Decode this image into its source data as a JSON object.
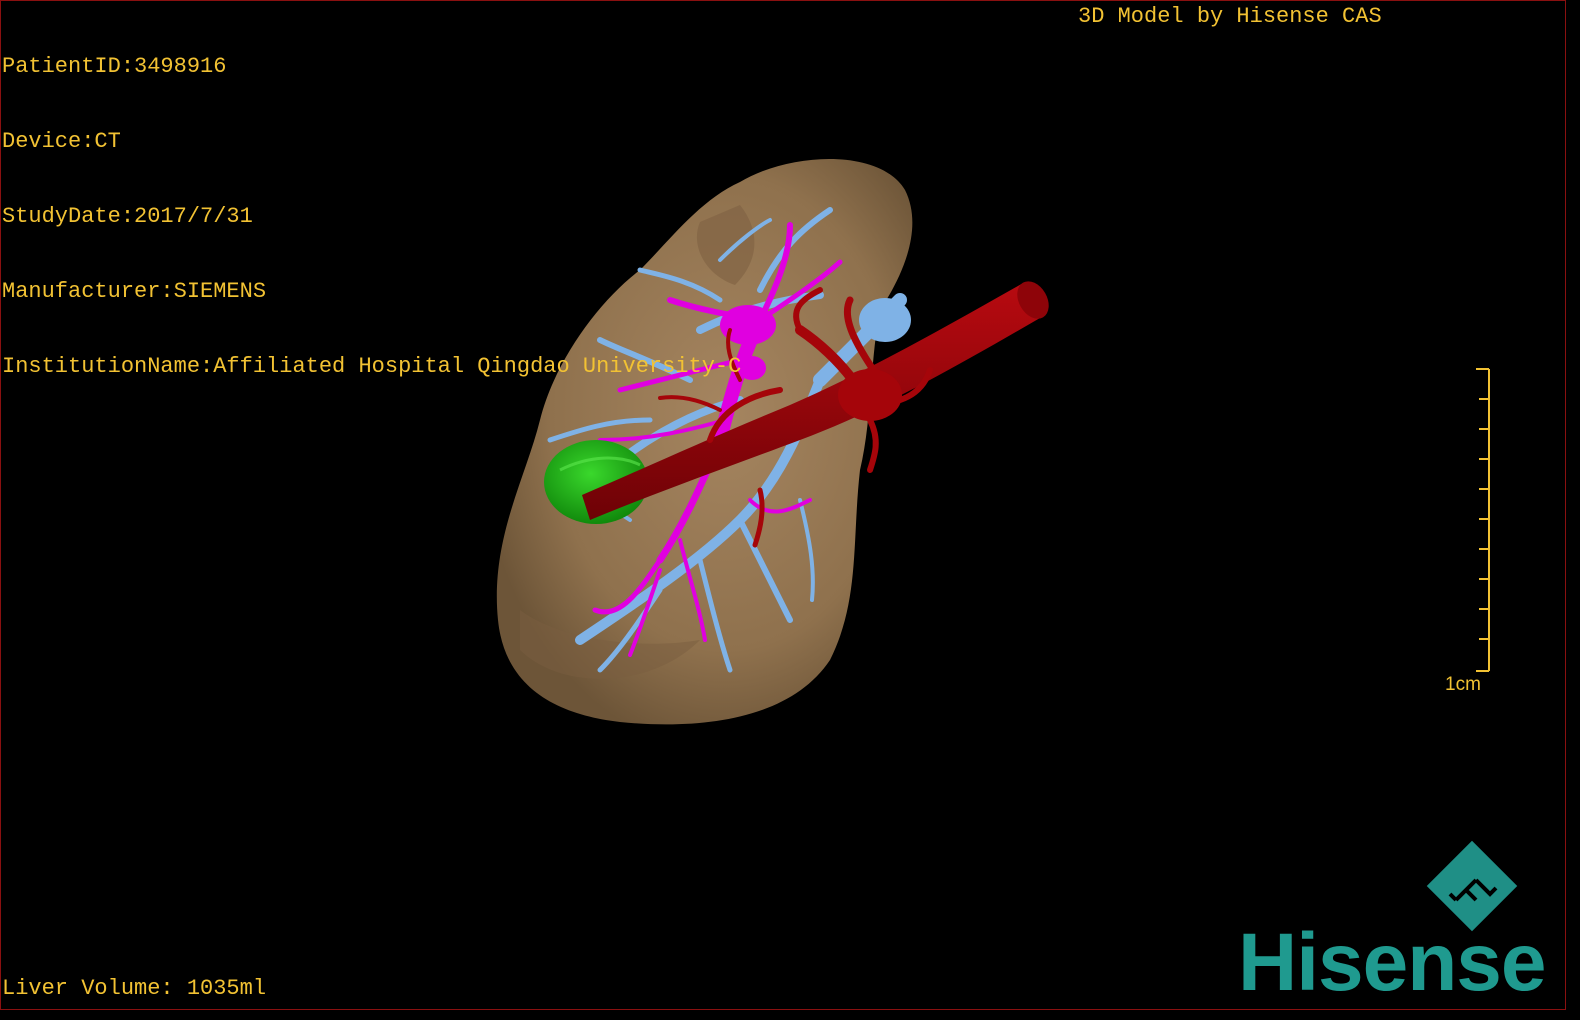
{
  "study_info": {
    "patient_id": "PatientID:3498916",
    "device": "Device:CT",
    "study_date": "StudyDate:2017/7/31",
    "manufacturer": "Manufacturer:SIEMENS",
    "institution": "InstitutionName:Affiliated Hospital Qingdao University-C"
  },
  "credit": "3D Model by Hisense CAS",
  "liver_volume": "Liver Volume: 1035ml",
  "scale_bar": {
    "label": "1cm",
    "ticks": 10
  },
  "brand": {
    "name": "Hisense",
    "mark_letters": "F L"
  },
  "colors": {
    "overlay_text": "#f2c233",
    "liver": "#9b7b56",
    "hepatic_vein": "#7fb2e6",
    "portal_vein": "#e000e0",
    "artery": "#a5050a",
    "tumor": "#1fb814",
    "brand": "#1f9a8f"
  },
  "structures": [
    "liver-surface",
    "hepatic-veins",
    "portal-veins",
    "hepatic-artery",
    "tumor"
  ]
}
